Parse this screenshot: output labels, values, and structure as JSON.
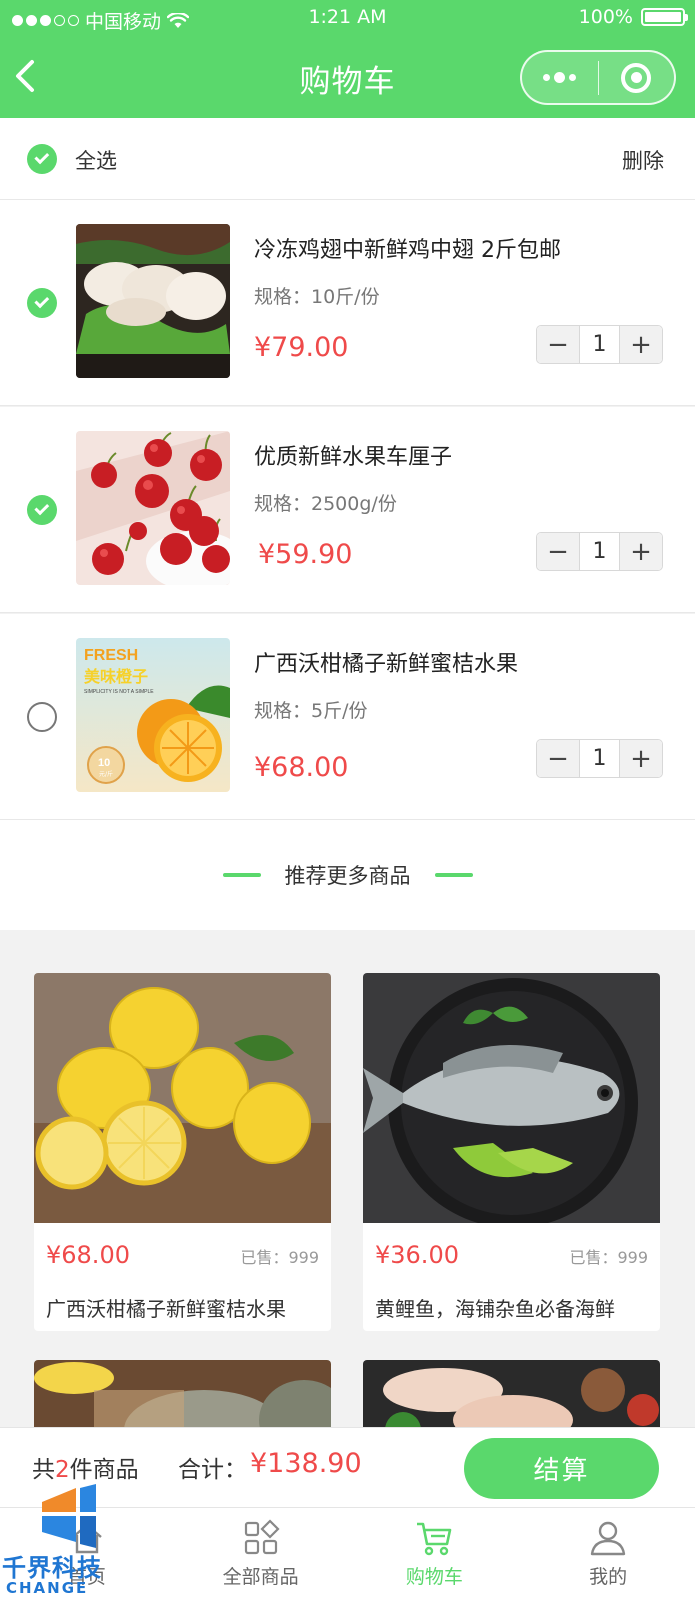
{
  "status_bar": {
    "carrier": "中国移动",
    "time": "1:21 AM",
    "battery": "100%"
  },
  "nav": {
    "title": "购物车"
  },
  "select_bar": {
    "select_all_label": "全选",
    "delete_label": "删除",
    "select_all_checked": true
  },
  "cart_items": [
    {
      "name": "冷冻鸡翅中新鲜鸡中翅 2斤包邮",
      "spec": "规格：10斤/份",
      "price": "¥79.00",
      "quantity": "1",
      "checked": true
    },
    {
      "name": "优质新鲜水果车厘子",
      "spec": "规格：2500g/份",
      "price": "¥59.90",
      "quantity": "1",
      "checked": true
    },
    {
      "name": "广西沃柑橘子新鲜蜜桔水果",
      "spec": "规格：5斤/份",
      "price": "¥68.00",
      "quantity": "1",
      "checked": false
    }
  ],
  "recommend": {
    "heading": "推荐更多商品",
    "products": [
      {
        "price": "¥68.00",
        "sold": "已售：999",
        "name": "广西沃柑橘子新鲜蜜桔水果"
      },
      {
        "price": "¥36.00",
        "sold": "已售：999",
        "name": "黄鲤鱼，海铺杂鱼必备海鲜"
      }
    ]
  },
  "orange_image_text": {
    "fresh": "FRESH",
    "title": "美味橙子",
    "subtitle": "SIMPLICITY IS NOT A SIMPLE",
    "badge_num": "10",
    "badge_unit": "元/斤"
  },
  "checkout": {
    "count_prefix": "共",
    "count_num": "2",
    "count_suffix": "件商品",
    "total_label": "合计：",
    "total": "¥138.90",
    "pay_label": "结算"
  },
  "tabs": [
    {
      "label": "首页",
      "icon": "home-icon"
    },
    {
      "label": "全部商品",
      "icon": "grid-icon"
    },
    {
      "label": "购物车",
      "icon": "cart-icon"
    },
    {
      "label": "我的",
      "icon": "user-icon"
    }
  ],
  "watermark": {
    "text": "千界科技",
    "sub": "CHANGE"
  },
  "colors": {
    "accent": "#5ad86c",
    "price": "#ef4a4a"
  }
}
